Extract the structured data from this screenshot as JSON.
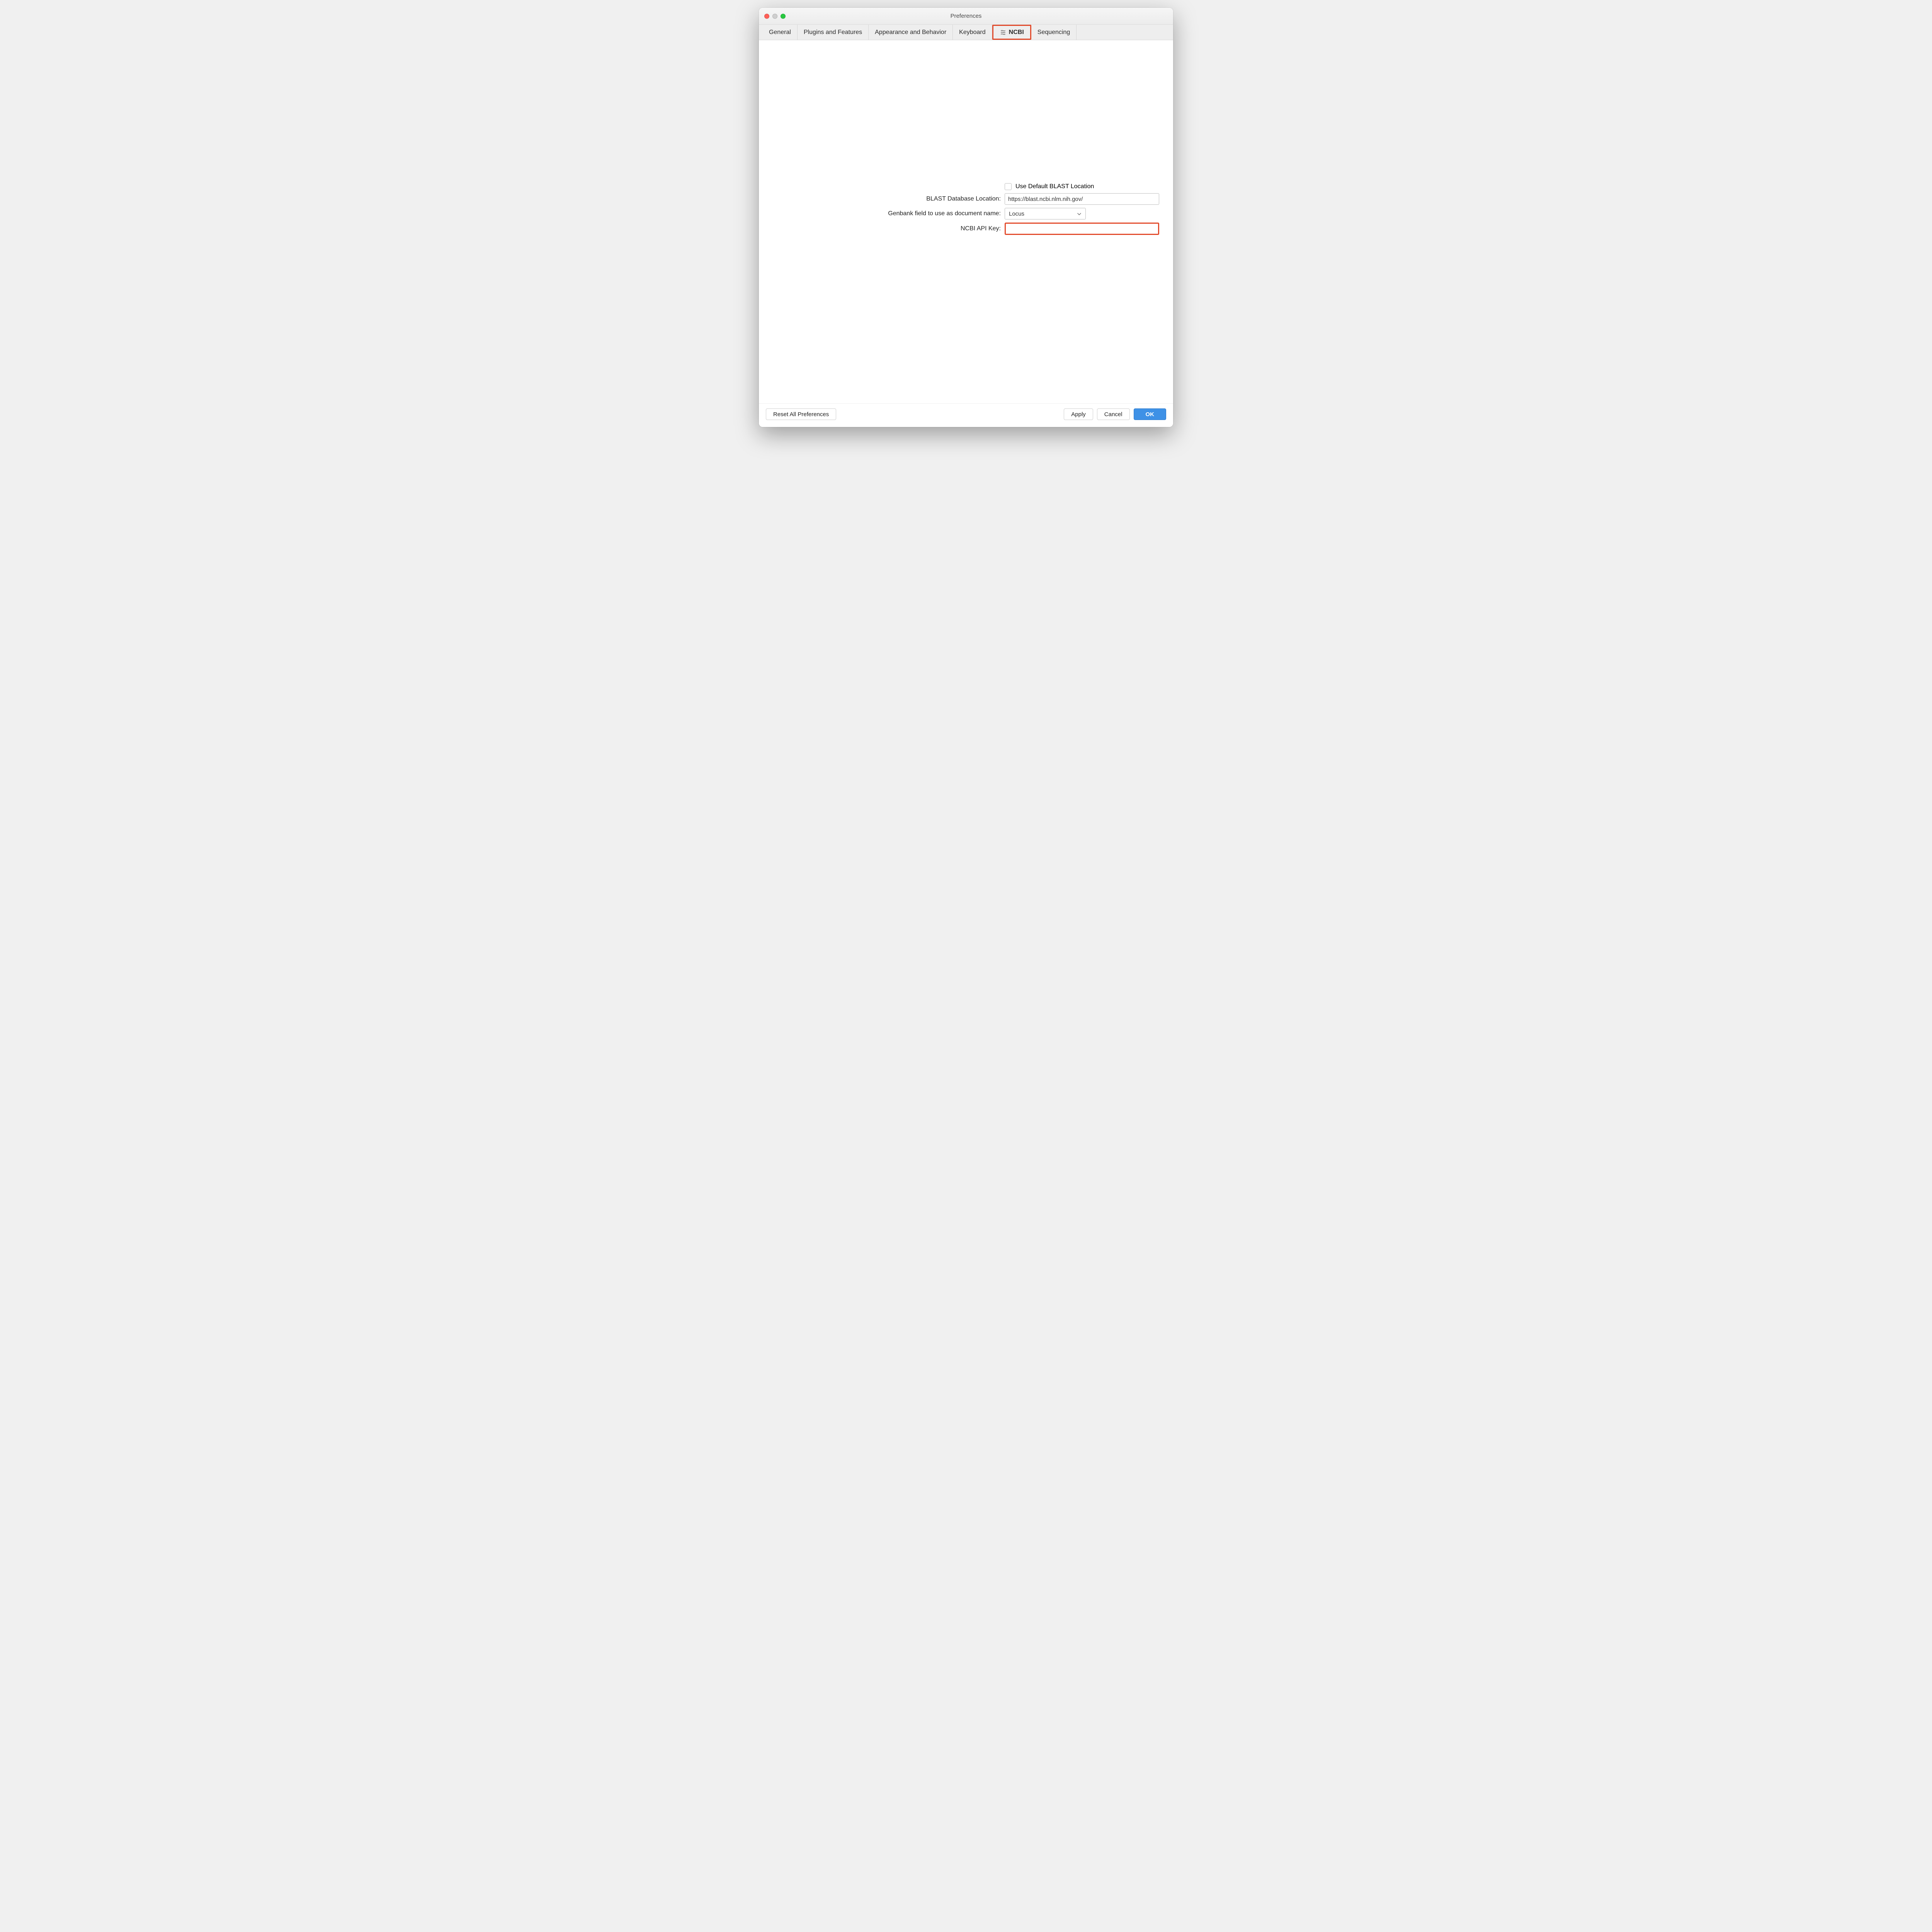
{
  "window": {
    "title": "Preferences"
  },
  "tabs": [
    {
      "label": "General",
      "active": false
    },
    {
      "label": "Plugins and Features",
      "active": false
    },
    {
      "label": "Appearance and Behavior",
      "active": false
    },
    {
      "label": "Keyboard",
      "active": false
    },
    {
      "label": "NCBI",
      "active": true,
      "icon": "ncbi-icon",
      "highlighted": true
    },
    {
      "label": "Sequencing",
      "active": false
    }
  ],
  "form": {
    "use_default_blast_label": "Use Default BLAST Location",
    "use_default_blast_checked": false,
    "blast_db_label": "BLAST Database Location:",
    "blast_db_value": "https://blast.ncbi.nlm.nih.gov/",
    "genbank_field_label": "Genbank field to use as document name:",
    "genbank_field_value": "Locus",
    "api_key_label": "NCBI API Key:",
    "api_key_value": "",
    "api_key_highlighted": true
  },
  "footer": {
    "reset_label": "Reset All Preferences",
    "apply_label": "Apply",
    "cancel_label": "Cancel",
    "ok_label": "OK"
  }
}
